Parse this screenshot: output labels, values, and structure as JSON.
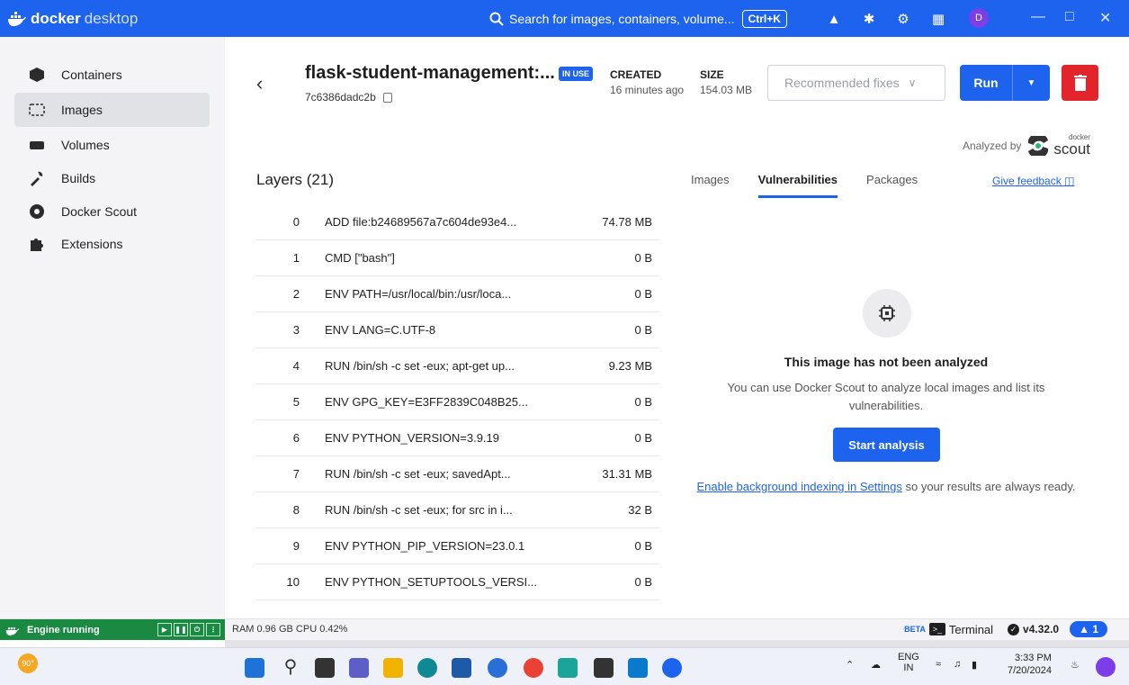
{
  "app": {
    "brand_bold": "docker",
    "brand_light": "desktop",
    "search_placeholder": "Search for images, containers, volume...",
    "search_shortcut": "Ctrl+K",
    "avatar_initial": "D"
  },
  "sidebar": {
    "items": [
      {
        "label": "Containers",
        "icon": "containers-icon"
      },
      {
        "label": "Images",
        "icon": "images-icon"
      },
      {
        "label": "Volumes",
        "icon": "volumes-icon"
      },
      {
        "label": "Builds",
        "icon": "builds-icon"
      },
      {
        "label": "Docker Scout",
        "icon": "docker-scout-icon"
      },
      {
        "label": "Extensions",
        "icon": "extensions-icon"
      }
    ],
    "active": "Images"
  },
  "header": {
    "title": "flask-student-management:...",
    "badge": "IN USE",
    "image_id": "7c6386dadc2b",
    "created_label": "CREATED",
    "created_value": "16 minutes ago",
    "size_label": "SIZE",
    "size_value": "154.03 MB",
    "fixes_placeholder": "Recommended fixes",
    "run_label": "Run"
  },
  "analyzed": {
    "text": "Analyzed by",
    "logo_small": "docker",
    "logo_big": "scout"
  },
  "layers": {
    "title": "Layers (21)",
    "rows": [
      {
        "idx": "0",
        "cmd": "ADD file:b24689567a7c604de93e4...",
        "size": "74.78 MB"
      },
      {
        "idx": "1",
        "cmd": "CMD [\"bash\"]",
        "size": "0 B"
      },
      {
        "idx": "2",
        "cmd": "ENV PATH=/usr/local/bin:/usr/loca...",
        "size": "0 B"
      },
      {
        "idx": "3",
        "cmd": "ENV LANG=C.UTF-8",
        "size": "0 B"
      },
      {
        "idx": "4",
        "cmd": "RUN /bin/sh -c set -eux; apt-get up...",
        "size": "9.23 MB"
      },
      {
        "idx": "5",
        "cmd": "ENV GPG_KEY=E3FF2839C048B25...",
        "size": "0 B"
      },
      {
        "idx": "6",
        "cmd": "ENV PYTHON_VERSION=3.9.19",
        "size": "0 B"
      },
      {
        "idx": "7",
        "cmd": "RUN /bin/sh -c set -eux; savedApt...",
        "size": "31.31 MB"
      },
      {
        "idx": "8",
        "cmd": "RUN /bin/sh -c set -eux; for src in i...",
        "size": "32 B"
      },
      {
        "idx": "9",
        "cmd": "ENV PYTHON_PIP_VERSION=23.0.1",
        "size": "0 B"
      },
      {
        "idx": "10",
        "cmd": "ENV PYTHON_SETUPTOOLS_VERSI...",
        "size": "0 B"
      }
    ]
  },
  "tabs": {
    "items": [
      "Images",
      "Vulnerabilities",
      "Packages"
    ],
    "active": "Vulnerabilities",
    "feedback": "Give feedback"
  },
  "empty_state": {
    "title": "This image has not been analyzed",
    "description": "You can use Docker Scout to analyze local images and list its vulnerabilities.",
    "button": "Start analysis",
    "link_text": "Enable background indexing in Settings",
    "link_suffix": " so your results are always ready."
  },
  "statusbar": {
    "engine": "Engine running",
    "resources": "RAM 0.96 GB  CPU 0.42%",
    "beta": "BETA",
    "terminal": "Terminal",
    "version": "v4.32.0",
    "notifications": "1"
  },
  "taskbar": {
    "weather": "90°",
    "lang_top": "ENG",
    "lang_bottom": "IN",
    "time": "3:33 PM",
    "date": "7/20/2024"
  },
  "colors": {
    "accent": "#1d63ed",
    "danger": "#e3242b",
    "engine": "#1a8a43"
  }
}
